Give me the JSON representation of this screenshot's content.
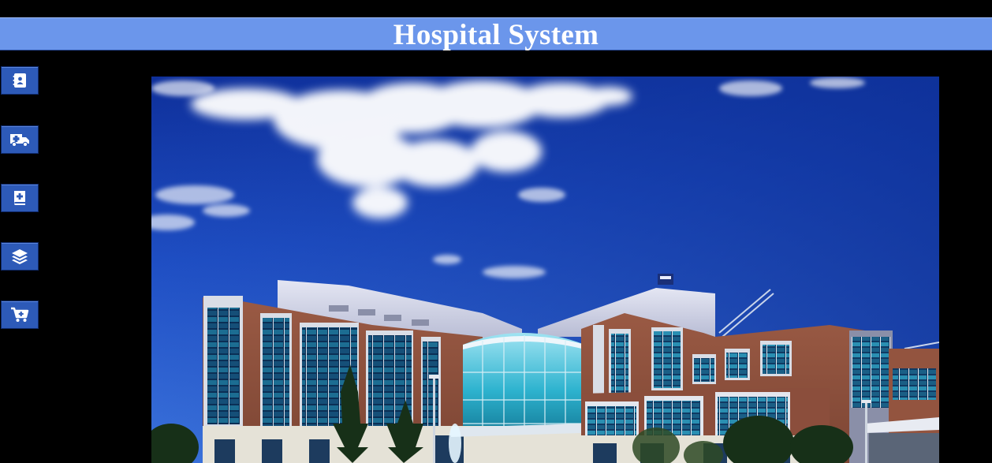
{
  "header": {
    "title": "Hospital System"
  },
  "sidebar": {
    "items": [
      {
        "icon": "contact-book-icon"
      },
      {
        "icon": "ambulance-icon"
      },
      {
        "icon": "medical-book-icon"
      },
      {
        "icon": "layers-icon"
      },
      {
        "icon": "shopping-cart-icon"
      }
    ]
  },
  "hero": {
    "image": "hospital-building-photo"
  },
  "colors": {
    "header_bg": "#6b96eb",
    "nav_button_bg": "#2d5ab8",
    "page_bg": "#000000"
  }
}
